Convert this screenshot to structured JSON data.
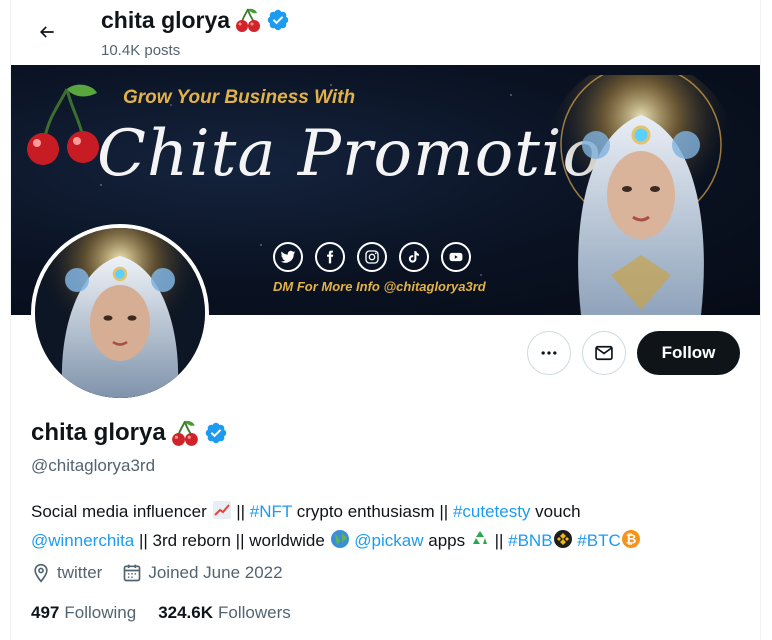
{
  "header": {
    "name": "chita glorya",
    "posts": "10.4K posts"
  },
  "banner": {
    "tagline": "Grow Your Business With",
    "script_title": "Chita Promotion",
    "dm_text": "DM For More Info @chitaglorya3rd",
    "social_icons": [
      "twitter-icon",
      "facebook-icon",
      "instagram-icon",
      "tiktok-icon",
      "youtube-icon"
    ]
  },
  "actions": {
    "follow_label": "Follow"
  },
  "profile": {
    "name": "chita glorya",
    "handle": "@chitaglorya3rd",
    "bio": {
      "p1": "Social media influencer",
      "p2": " || ",
      "nft": "#NFT",
      "p3": " crypto enthusiasm || ",
      "cutetesty": "#cutetesty",
      "p4": " vouch",
      "winnerchita": "@winnerchita",
      "p5": " || 3rd reborn || worldwide ",
      "pickaw": "@pickaw",
      "p6": " apps ",
      "p7": " || ",
      "bnb": "#BNB",
      "btc": "#BTC"
    },
    "location": "twitter",
    "joined": "Joined June 2022",
    "following_count": "497",
    "following_label": "Following",
    "followers_count": "324.6K",
    "followers_label": "Followers"
  },
  "colors": {
    "accent": "#1d9bf0",
    "verified": "#1d9bf0",
    "follow_button": "#0f1419",
    "banner_gold": "#e2b24a"
  }
}
